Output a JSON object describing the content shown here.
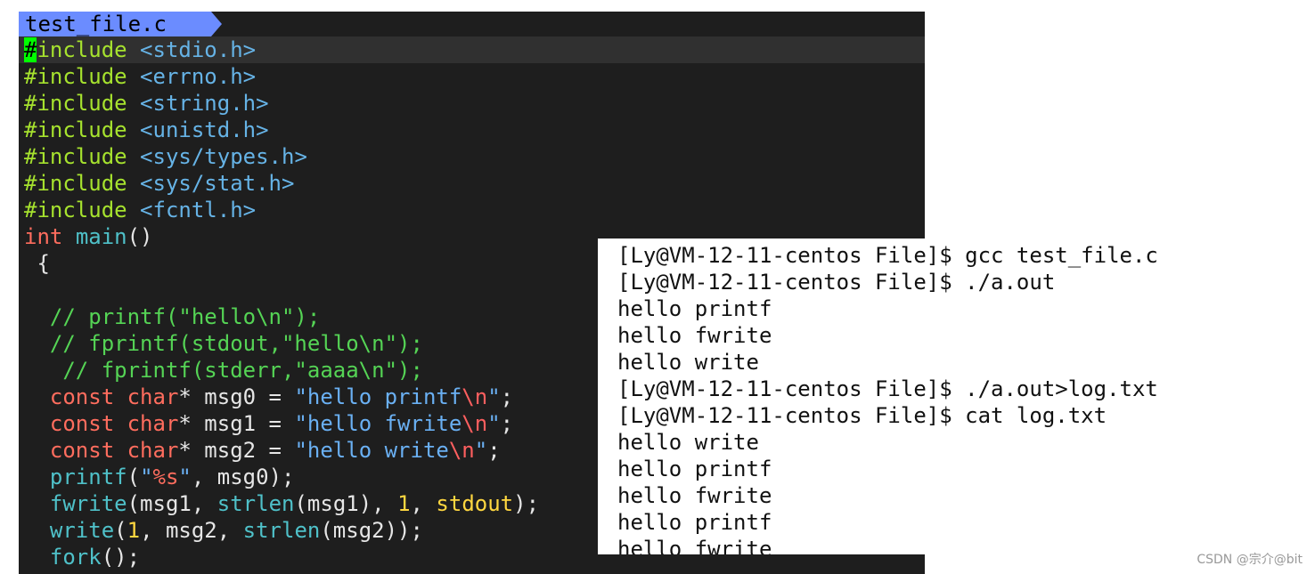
{
  "editor": {
    "tab_label": "test_file.c",
    "colors": {
      "background": "#1e1e1e",
      "tab": "#6b8cff",
      "cursor": "#00ff00",
      "preprocessor": "#a6e22e",
      "header": "#66b3e6",
      "keyword": "#ff6d5e",
      "function": "#4fc1c9",
      "comment": "#55d455",
      "string": "#6ab0f3",
      "number": "#ffd740"
    },
    "lines": [
      {
        "segs": [
          {
            "c": "cursor",
            "t": "#"
          },
          {
            "c": "pp",
            "t": "include "
          },
          {
            "c": "hdr",
            "t": "<stdio.h>"
          }
        ]
      },
      {
        "segs": [
          {
            "c": "pp",
            "t": "#include "
          },
          {
            "c": "hdr",
            "t": "<errno.h>"
          }
        ]
      },
      {
        "segs": [
          {
            "c": "pp",
            "t": "#include "
          },
          {
            "c": "hdr",
            "t": "<string.h>"
          }
        ]
      },
      {
        "segs": [
          {
            "c": "pp",
            "t": "#include "
          },
          {
            "c": "hdr",
            "t": "<unistd.h>"
          }
        ]
      },
      {
        "segs": [
          {
            "c": "pp",
            "t": "#include "
          },
          {
            "c": "hdr",
            "t": "<sys/types.h>"
          }
        ]
      },
      {
        "segs": [
          {
            "c": "pp",
            "t": "#include "
          },
          {
            "c": "hdr",
            "t": "<sys/stat.h>"
          }
        ]
      },
      {
        "segs": [
          {
            "c": "pp",
            "t": "#include "
          },
          {
            "c": "hdr",
            "t": "<fcntl.h>"
          }
        ]
      },
      {
        "segs": [
          {
            "c": "kw",
            "t": "int"
          },
          {
            "c": "pl",
            "t": " "
          },
          {
            "c": "fn",
            "t": "main"
          },
          {
            "c": "pl",
            "t": "()"
          }
        ]
      },
      {
        "segs": [
          {
            "c": "pl",
            "t": " {"
          }
        ]
      },
      {
        "segs": [
          {
            "c": "pl",
            "t": ""
          }
        ]
      },
      {
        "segs": [
          {
            "c": "cm",
            "t": "  // printf(\"hello\\n\");"
          }
        ]
      },
      {
        "segs": [
          {
            "c": "cm",
            "t": "  // fprintf(stdout,\"hello\\n\");"
          }
        ]
      },
      {
        "segs": [
          {
            "c": "cm",
            "t": "   // fprintf(stderr,\"aaaa\\n\");"
          }
        ]
      },
      {
        "segs": [
          {
            "c": "pl",
            "t": "  "
          },
          {
            "c": "kw",
            "t": "const"
          },
          {
            "c": "pl",
            "t": " "
          },
          {
            "c": "ty",
            "t": "char"
          },
          {
            "c": "pl",
            "t": "* msg0 = "
          },
          {
            "c": "st",
            "t": "\"hello printf"
          },
          {
            "c": "esc",
            "t": "\\n"
          },
          {
            "c": "st",
            "t": "\""
          },
          {
            "c": "pl",
            "t": ";"
          }
        ]
      },
      {
        "segs": [
          {
            "c": "pl",
            "t": "  "
          },
          {
            "c": "kw",
            "t": "const"
          },
          {
            "c": "pl",
            "t": " "
          },
          {
            "c": "ty",
            "t": "char"
          },
          {
            "c": "pl",
            "t": "* msg1 = "
          },
          {
            "c": "st",
            "t": "\"hello fwrite"
          },
          {
            "c": "esc",
            "t": "\\n"
          },
          {
            "c": "st",
            "t": "\""
          },
          {
            "c": "pl",
            "t": ";"
          }
        ]
      },
      {
        "segs": [
          {
            "c": "pl",
            "t": "  "
          },
          {
            "c": "kw",
            "t": "const"
          },
          {
            "c": "pl",
            "t": " "
          },
          {
            "c": "ty",
            "t": "char"
          },
          {
            "c": "pl",
            "t": "* msg2 = "
          },
          {
            "c": "st",
            "t": "\"hello write"
          },
          {
            "c": "esc",
            "t": "\\n"
          },
          {
            "c": "st",
            "t": "\""
          },
          {
            "c": "pl",
            "t": ";"
          }
        ]
      },
      {
        "segs": [
          {
            "c": "pl",
            "t": "  "
          },
          {
            "c": "fn",
            "t": "printf"
          },
          {
            "c": "pl",
            "t": "("
          },
          {
            "c": "st",
            "t": "\""
          },
          {
            "c": "fmt",
            "t": "%s"
          },
          {
            "c": "st",
            "t": "\""
          },
          {
            "c": "pl",
            "t": ", msg0);"
          }
        ]
      },
      {
        "segs": [
          {
            "c": "pl",
            "t": "  "
          },
          {
            "c": "fn",
            "t": "fwrite"
          },
          {
            "c": "pl",
            "t": "(msg1, "
          },
          {
            "c": "fn",
            "t": "strlen"
          },
          {
            "c": "pl",
            "t": "(msg1), "
          },
          {
            "c": "num",
            "t": "1"
          },
          {
            "c": "pl",
            "t": ", "
          },
          {
            "c": "sv",
            "t": "stdout"
          },
          {
            "c": "pl",
            "t": ");"
          }
        ]
      },
      {
        "segs": [
          {
            "c": "pl",
            "t": "  "
          },
          {
            "c": "fn",
            "t": "write"
          },
          {
            "c": "pl",
            "t": "("
          },
          {
            "c": "num",
            "t": "1"
          },
          {
            "c": "pl",
            "t": ", msg2, "
          },
          {
            "c": "fn",
            "t": "strlen"
          },
          {
            "c": "pl",
            "t": "(msg2));"
          }
        ]
      },
      {
        "segs": [
          {
            "c": "pl",
            "t": "  "
          },
          {
            "c": "fn",
            "t": "fork"
          },
          {
            "c": "pl",
            "t": "();"
          }
        ]
      }
    ]
  },
  "terminal": {
    "lines": [
      "[Ly@VM-12-11-centos File]$ gcc test_file.c",
      "[Ly@VM-12-11-centos File]$ ./a.out",
      "hello printf",
      "hello fwrite",
      "hello write",
      "[Ly@VM-12-11-centos File]$ ./a.out>log.txt",
      "[Ly@VM-12-11-centos File]$ cat log.txt",
      "hello write",
      "hello printf",
      "hello fwrite",
      "hello printf",
      "hello fwrite"
    ]
  },
  "watermark": "CSDN @宗介@bit"
}
